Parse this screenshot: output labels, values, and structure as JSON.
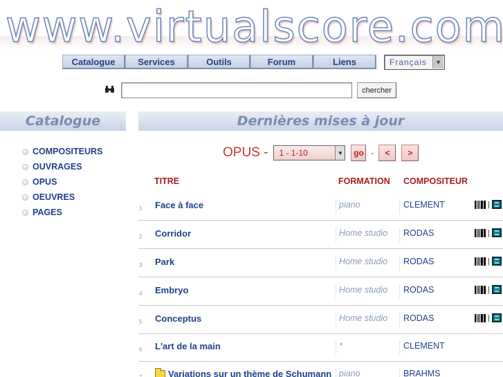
{
  "logo": {
    "text": "www.virtualscore.com"
  },
  "nav": {
    "items": [
      {
        "label": "Catalogue"
      },
      {
        "label": "Services"
      },
      {
        "label": "Outils"
      },
      {
        "label": "Forum"
      },
      {
        "label": "Liens"
      }
    ],
    "language": {
      "selected": "Français"
    }
  },
  "search": {
    "value": "",
    "button_label": "chercher"
  },
  "sidebar": {
    "title": "Catalogue",
    "items": [
      {
        "label": "COMPOSITEURS"
      },
      {
        "label": "OUVRAGES"
      },
      {
        "label": "OPUS"
      },
      {
        "label": "OEUVRES"
      },
      {
        "label": "PAGES"
      }
    ]
  },
  "main": {
    "title": "Dernières mises à jour",
    "opus": {
      "label": "OPUS -",
      "selected": "1 - 1-10",
      "go_label": "go",
      "separator": "-",
      "prev_label": "<",
      "next_label": ">"
    },
    "columns": {
      "title": "TITRE",
      "formation": "FORMATION",
      "composer": "COMPOSITEUR"
    },
    "rows": [
      {
        "num": "1",
        "title": "Face à face",
        "formation": "piano",
        "composer": "CLEMENT",
        "icons": true,
        "folder": false
      },
      {
        "num": "2",
        "title": "Corridor",
        "formation": "Home studio",
        "composer": "RODAS",
        "icons": true,
        "folder": false
      },
      {
        "num": "3",
        "title": "Park",
        "formation": "Home studio",
        "composer": "RODAS",
        "icons": true,
        "folder": false
      },
      {
        "num": "4",
        "title": "Embryo",
        "formation": "Home studio",
        "composer": "RODAS",
        "icons": true,
        "folder": false
      },
      {
        "num": "5",
        "title": "Conceptus",
        "formation": "Home studio",
        "composer": "RODAS",
        "icons": true,
        "folder": false
      },
      {
        "num": "6",
        "title": "L'art de la main",
        "formation": "*",
        "composer": "CLEMENT",
        "icons": false,
        "folder": false
      },
      {
        "num": "7",
        "title": "Variations sur un thème de Schumann",
        "formation": "piano",
        "composer": "BRAHMS",
        "icons": false,
        "folder": true
      }
    ],
    "icon_separator": "|"
  }
}
